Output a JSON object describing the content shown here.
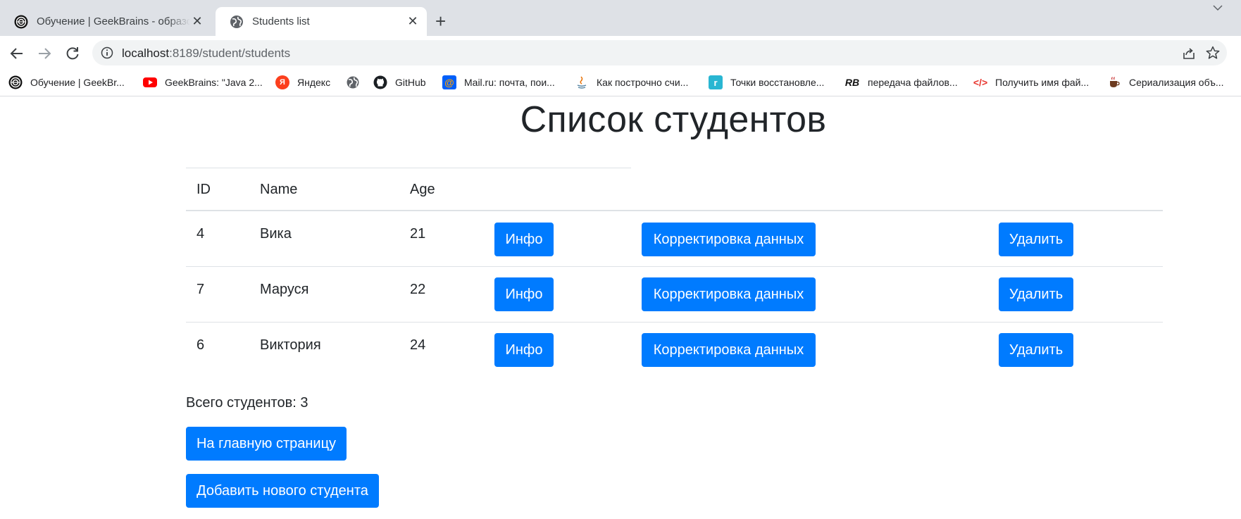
{
  "browser": {
    "tabs": [
      {
        "title": "Обучение | GeekBrains - образовательный портал",
        "icon": "geekbrains-logo-icon",
        "active": false
      },
      {
        "title": "Students list",
        "icon": "globe-icon",
        "active": true
      }
    ],
    "address": {
      "host": "localhost",
      "path": ":8189/student/students"
    },
    "bookmarks": [
      {
        "label": "Обучение | GeekBr...",
        "icon": "geekbrains-logo-icon"
      },
      {
        "label": "GeekBrains: \"Java 2...",
        "icon": "youtube-icon"
      },
      {
        "label": "Яндекс",
        "icon": "yandex-icon"
      },
      {
        "label": "",
        "icon": "globe-icon"
      },
      {
        "label": "GitHub",
        "icon": "github-icon"
      },
      {
        "label": "Mail.ru: почта, пои...",
        "icon": "mailru-icon"
      },
      {
        "label": "Как построчно счи...",
        "icon": "java-icon"
      },
      {
        "label": "Точки восстановле...",
        "icon": "restore-icon"
      },
      {
        "label": "передача файлов...",
        "icon": "rb-icon"
      },
      {
        "label": "Получить имя фай...",
        "icon": "code-icon"
      },
      {
        "label": "Сериализация объ...",
        "icon": "coffee-icon"
      }
    ]
  },
  "page": {
    "title": "Список студентов",
    "columns": [
      "ID",
      "Name",
      "Age"
    ],
    "students": [
      {
        "id": "4",
        "name": "Вика",
        "age": "21"
      },
      {
        "id": "7",
        "name": "Маруся",
        "age": "22"
      },
      {
        "id": "6",
        "name": "Виктория",
        "age": "24"
      }
    ],
    "row_buttons": {
      "info": "Инфо",
      "edit": "Корректировка данных",
      "delete": "Удалить"
    },
    "total_label": "Всего студентов: 3",
    "home_button": "На главную страницу",
    "add_button": "Добавить нового студента"
  },
  "colors": {
    "primary": "#007bff",
    "text": "#212529",
    "border": "#dee2e6"
  }
}
